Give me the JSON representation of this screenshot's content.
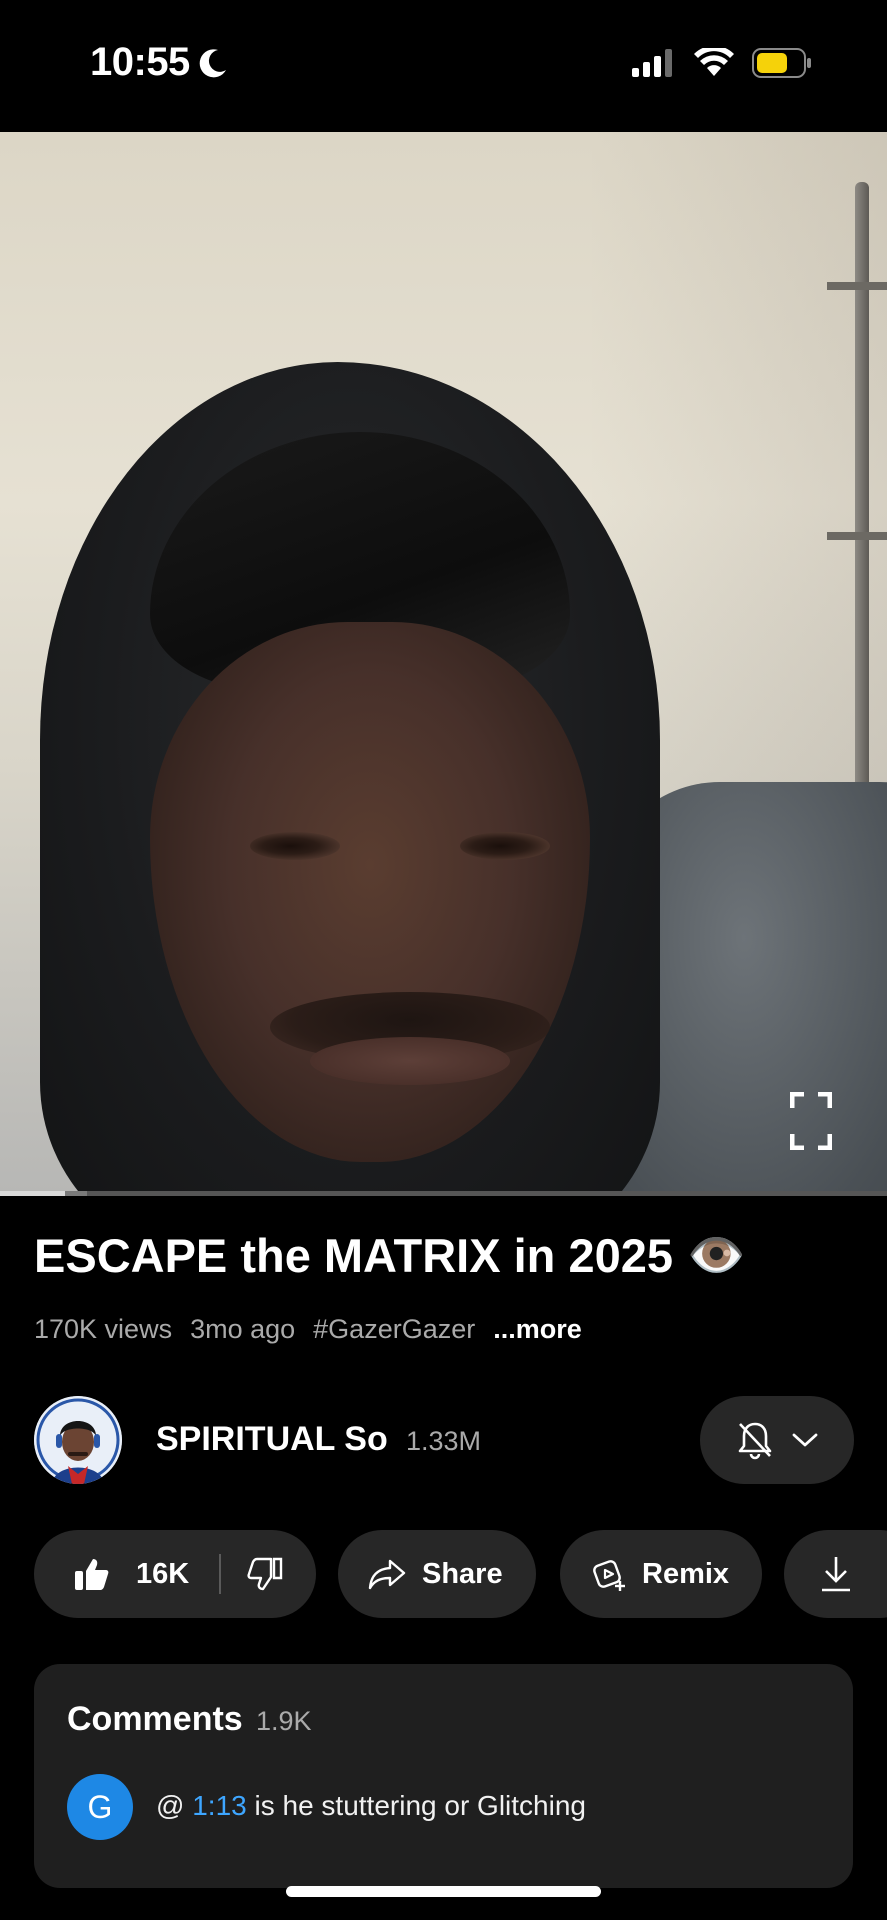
{
  "status_bar": {
    "time": "10:55",
    "focus_icon": "moon-icon",
    "signal_icon": "cellular-signal-icon",
    "wifi_icon": "wifi-icon",
    "battery_icon": "battery-low-power-icon",
    "battery_color": "#f5d20a"
  },
  "video": {
    "progress": 0.073,
    "buffered": 0.098,
    "fullscreen_icon": "fullscreen-icon"
  },
  "info": {
    "title": "ESCAPE the MATRIX in 2025",
    "title_emoji": "👁️",
    "views": "170K views",
    "age": "3mo ago",
    "hashtag": "#GazerGazer",
    "more_label": "...more"
  },
  "channel": {
    "name": "SPIRITUAL So",
    "subscribers": "1.33M",
    "bell_icon": "bell-off-icon",
    "chevron_icon": "chevron-down-icon"
  },
  "actions": {
    "like_count": "16K",
    "like_icon": "thumbs-up-icon",
    "dislike_icon": "thumbs-down-icon",
    "share_label": "Share",
    "share_icon": "share-icon",
    "remix_label": "Remix",
    "remix_icon": "remix-icon",
    "download_icon": "download-icon"
  },
  "comments": {
    "title": "Comments",
    "count": "1.9K",
    "top_comment": {
      "avatar_letter": "G",
      "avatar_color": "#1e88e5",
      "prefix": "@",
      "timestamp": "1:13",
      "text": "is he stuttering or Glitching"
    }
  },
  "colors": {
    "background": "#000000",
    "pill": "#272727",
    "card": "#1f1f1f",
    "secondary_text": "#aaaaaa",
    "link": "#3ea6ff"
  }
}
